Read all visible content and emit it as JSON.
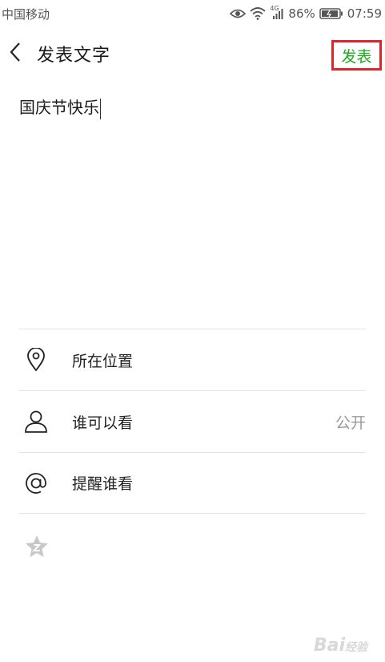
{
  "status_bar": {
    "carrier": "中国移动",
    "network": "4G",
    "battery": "86%",
    "time": "07:59",
    "icons": [
      "eye-icon",
      "wifi-icon",
      "signal-icon",
      "battery-icon"
    ]
  },
  "header": {
    "title": "发表文字",
    "publish_label": "发表",
    "back_icon": "chevron-left-icon"
  },
  "compose": {
    "text": "国庆节快乐"
  },
  "options": [
    {
      "icon": "location-pin-icon",
      "label": "所在位置",
      "value": ""
    },
    {
      "icon": "person-icon",
      "label": "谁可以看",
      "value": "公开"
    },
    {
      "icon": "at-sign-icon",
      "label": "提醒谁看",
      "value": ""
    }
  ],
  "colors": {
    "publish_green": "#1aad19",
    "highlight_red": "#e0242c",
    "divider": "#e3e3e3",
    "muted_text": "#9a9a9a"
  }
}
